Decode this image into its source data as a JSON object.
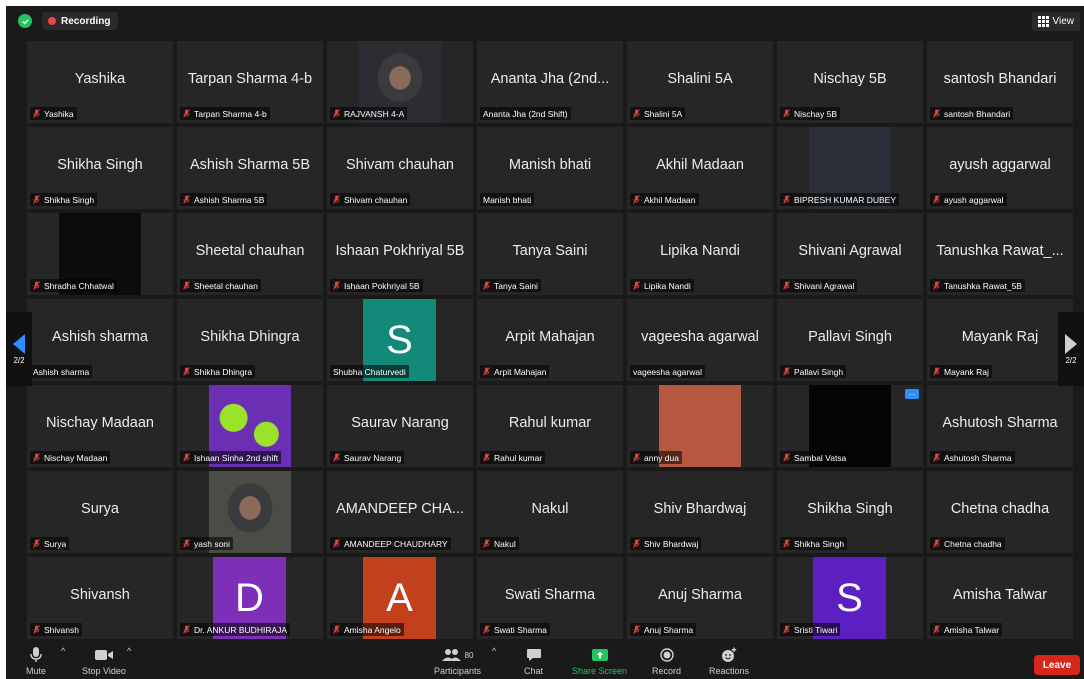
{
  "topbar": {
    "shield_icon": "shield-check-icon",
    "recording_label": "Recording",
    "view_label": "View"
  },
  "colors": {
    "accent": "#2d8cff",
    "recording": "#ef4444",
    "leave": "#d7261c",
    "share_screen": "#22c55e"
  },
  "pager": {
    "left_label": "2/2",
    "right_label": "2/2"
  },
  "participants": [
    {
      "center": "Yashika",
      "label": "Yashika",
      "muted": true
    },
    {
      "center": "Tarpan Sharma 4-b",
      "label": "Tarpan Sharma 4-b",
      "muted": true
    },
    {
      "center": "",
      "label": "RAJVANSH 4-A",
      "muted": true,
      "media": "photo",
      "color": "#2b2d33"
    },
    {
      "center": "Ananta Jha (2nd...",
      "label": "Ananta Jha (2nd Shift)",
      "muted": false
    },
    {
      "center": "Shalini 5A",
      "label": "Shalini 5A",
      "muted": true
    },
    {
      "center": "Nischay 5B",
      "label": "Nischay 5B",
      "muted": true
    },
    {
      "center": "santosh Bhandari",
      "label": "santosh Bhandari",
      "muted": true
    },
    {
      "center": "Shikha Singh",
      "label": "Shikha Singh",
      "muted": true
    },
    {
      "center": "Ashish Sharma 5B",
      "label": "Ashish Sharma 5B",
      "muted": true
    },
    {
      "center": "Shivam chauhan",
      "label": "Shivam chauhan",
      "muted": true
    },
    {
      "center": "Manish bhati",
      "label": "Manish bhati",
      "muted": false
    },
    {
      "center": "Akhil Madaan",
      "label": "Akhil Madaan",
      "muted": true
    },
    {
      "center": "",
      "label": "BIPRESH KUMAR DUBEY",
      "muted": true,
      "media": "video",
      "color": "#2a2f38"
    },
    {
      "center": "ayush aggarwal",
      "label": "ayush aggarwal",
      "muted": true
    },
    {
      "center": "",
      "label": "Shradha Chhatwal",
      "muted": true,
      "media": "video",
      "color": "#0c0c0c"
    },
    {
      "center": "Sheetal chauhan",
      "label": "Sheetal chauhan",
      "muted": true
    },
    {
      "center": "Ishaan Pokhriyal 5B",
      "label": "Ishaan Pokhriyal 5B",
      "muted": true
    },
    {
      "center": "Tanya Saini",
      "label": "Tanya Saini",
      "muted": true
    },
    {
      "center": "Lipika Nandi",
      "label": "Lipika Nandi",
      "muted": true
    },
    {
      "center": "Shivani Agrawal",
      "label": "Shivani Agrawal",
      "muted": true
    },
    {
      "center": "Tanushka Rawat_...",
      "label": "Tanushka Rawat_5B",
      "muted": true
    },
    {
      "center": "Ashish sharma",
      "label": "Ashish sharma",
      "muted": false
    },
    {
      "center": "Shikha Dhingra",
      "label": "Shikha Dhingra",
      "muted": true
    },
    {
      "center": "",
      "label": "Shubha Chaturvedi",
      "muted": false,
      "media": "avatar",
      "letter": "S",
      "color": "#13897a"
    },
    {
      "center": "Arpit Mahajan",
      "label": "Arpit Mahajan",
      "muted": true
    },
    {
      "center": "vageesha agarwal",
      "label": "vageesha agarwal",
      "muted": false
    },
    {
      "center": "Pallavi Singh",
      "label": "Pallavi Singh",
      "muted": true
    },
    {
      "center": "Mayank Raj",
      "label": "Mayank Raj",
      "muted": true
    },
    {
      "center": "Nischay Madaan",
      "label": "Nischay Madaan",
      "muted": true
    },
    {
      "center": "",
      "label": "Ishaan Sinha 2nd shift",
      "muted": true,
      "media": "art",
      "color": "#6b2fb3"
    },
    {
      "center": "Saurav Narang",
      "label": "Saurav Narang",
      "muted": true
    },
    {
      "center": "Rahul kumar",
      "label": "Rahul kumar",
      "muted": true
    },
    {
      "center": "",
      "label": "anny dua",
      "muted": true,
      "media": "video",
      "color": "#b5583f"
    },
    {
      "center": "",
      "label": "Sambal Vatsa",
      "muted": true,
      "media": "video",
      "color": "#050505",
      "dots": true
    },
    {
      "center": "Ashutosh Sharma",
      "label": "Ashutosh Sharma",
      "muted": true
    },
    {
      "center": "Surya",
      "label": "Surya",
      "muted": true
    },
    {
      "center": "",
      "label": "yash soni",
      "muted": true,
      "media": "photo",
      "color": "#4a4d45"
    },
    {
      "center": "AMANDEEP CHA...",
      "label": "AMANDEEP CHAUDHARY",
      "muted": true
    },
    {
      "center": "Nakul",
      "label": "Nakul",
      "muted": true
    },
    {
      "center": "Shiv Bhardwaj",
      "label": "Shiv Bhardwaj",
      "muted": true
    },
    {
      "center": "Shikha Singh",
      "label": "Shikha Singh",
      "muted": true
    },
    {
      "center": "Chetna chadha",
      "label": "Chetna chadha",
      "muted": true
    },
    {
      "center": "Shivansh",
      "label": "Shivansh",
      "muted": true
    },
    {
      "center": "",
      "label": "Dr. ANKUR BUDHIRAJA",
      "muted": true,
      "media": "avatar",
      "letter": "D",
      "color": "#7d2fb7"
    },
    {
      "center": "",
      "label": "Amisha Angelo",
      "muted": true,
      "media": "avatar",
      "letter": "A",
      "color": "#c3401d"
    },
    {
      "center": "Swati Sharma",
      "label": "Swati Sharma",
      "muted": true
    },
    {
      "center": "Anuj Sharma",
      "label": "Anuj Sharma",
      "muted": true
    },
    {
      "center": "",
      "label": "Sristi Tiwari",
      "muted": true,
      "media": "avatar",
      "letter": "S",
      "color": "#5b1fc2"
    },
    {
      "center": "Amisha Talwar",
      "label": "Amisha Talwar",
      "muted": true
    }
  ],
  "toolbar": {
    "mute": "Mute",
    "stop_video": "Stop Video",
    "participants": "Participants",
    "participants_count": "80",
    "chat": "Chat",
    "share_screen": "Share Screen",
    "record": "Record",
    "reactions": "Reactions",
    "leave": "Leave"
  }
}
